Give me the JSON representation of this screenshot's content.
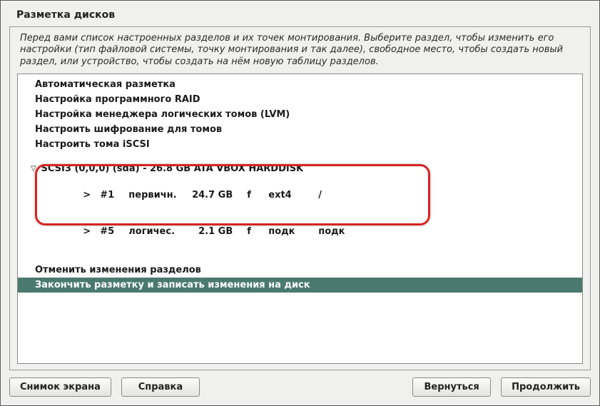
{
  "title": "Разметка дисков",
  "intro": "Перед вами список настроенных разделов и их точек монтирования. Выберите раздел, чтобы изменить его настройки (тип файловой системы, точку монтирования и так далее), свободное место, чтобы создать новый раздел, или устройство, чтобы создать на нём новую таблицу разделов.",
  "options": {
    "auto": "Автоматическая разметка",
    "raid": "Настройка программного RAID",
    "lvm": "Настройка менеджера логических томов (LVM)",
    "crypto": "Настроить шифрование для томов",
    "iscsi": "Настроить тома iSCSI"
  },
  "disk": {
    "header": "SCSI3 (0,0,0) (sda) - 26.8 GB ATA VBOX HARDDISK",
    "partitions": [
      {
        "arrow": ">",
        "num": "#1",
        "type": "первичн.",
        "size": "24.7 GB",
        "f": "f",
        "fs": "ext4",
        "mnt": "/"
      },
      {
        "arrow": ">",
        "num": "#5",
        "type": "логичес.",
        "size": "2.1 GB",
        "f": "f",
        "fs": "подк",
        "mnt": "подк"
      }
    ]
  },
  "actions": {
    "undo": "Отменить изменения разделов",
    "finish": "Закончить разметку и записать изменения на диск"
  },
  "buttons": {
    "screenshot": "Снимок экрана",
    "help": "Справка",
    "back": "Вернуться",
    "continue": "Продолжить"
  }
}
